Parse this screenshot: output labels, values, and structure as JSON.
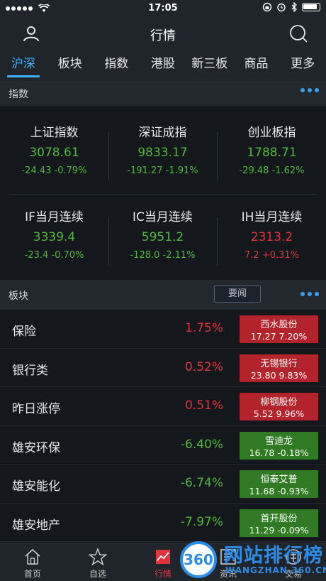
{
  "status_bar": {
    "time": "17:05"
  },
  "nav": {
    "title": "行情"
  },
  "tabs": [
    {
      "label": "沪深",
      "active": true
    },
    {
      "label": "板块"
    },
    {
      "label": "指数"
    },
    {
      "label": "港股"
    },
    {
      "label": "新三板"
    },
    {
      "label": "商品"
    },
    {
      "label": "更多"
    }
  ],
  "indices_section": {
    "label": "指数"
  },
  "indices": [
    {
      "name": "上证指数",
      "price": "3078.61",
      "change": "-24.43 -0.79%",
      "trend": "down"
    },
    {
      "name": "深证成指",
      "price": "9833.17",
      "change": "-191.27 -1.91%",
      "trend": "down"
    },
    {
      "name": "创业板指",
      "price": "1788.71",
      "change": "-29.48 -1.62%",
      "trend": "down"
    },
    {
      "name": "IF当月连续",
      "price": "3339.4",
      "change": "-23.4 -0.70%",
      "trend": "down"
    },
    {
      "name": "IC当月连续",
      "price": "5951.2",
      "change": "-128.0 -2.11%",
      "trend": "down"
    },
    {
      "name": "IH当月连续",
      "price": "2313.2",
      "change": "7.2 +0.31%",
      "trend": "up"
    }
  ],
  "sectors_section": {
    "label": "板块",
    "news_button": "要闻"
  },
  "sectors": [
    {
      "name": "保险",
      "pct": "1.75%",
      "trend": "up",
      "stock": "西水股份",
      "stock_info": "17.27 7.20%"
    },
    {
      "name": "银行类",
      "pct": "0.52%",
      "trend": "up",
      "stock": "无锡银行",
      "stock_info": "23.80 9.83%"
    },
    {
      "name": "昨日涨停",
      "pct": "0.51%",
      "trend": "up",
      "stock": "柳钢股份",
      "stock_info": "5.52 9.96%"
    },
    {
      "name": "雄安环保",
      "pct": "-6.40%",
      "trend": "down",
      "stock": "雪迪龙",
      "stock_info": "16.78 -0.18%"
    },
    {
      "name": "雄安能化",
      "pct": "-6.74%",
      "trend": "down",
      "stock": "恒泰艾普",
      "stock_info": "11.68 -0.93%"
    },
    {
      "name": "雄安地产",
      "pct": "-7.97%",
      "trend": "down",
      "stock": "首开股份",
      "stock_info": "11.29 -0.09%"
    }
  ],
  "bottom_nav": [
    {
      "label": "首页",
      "icon": "home-icon"
    },
    {
      "label": "自选",
      "icon": "star-icon"
    },
    {
      "label": "行情",
      "icon": "chart-icon",
      "active": true
    },
    {
      "label": "资讯",
      "icon": "news-icon"
    },
    {
      "label": "交易",
      "icon": "trade-icon"
    }
  ],
  "watermark": {
    "badge": "360",
    "title": "网站排行榜",
    "subtitle": "WANGZHAN.360.CN"
  },
  "colors": {
    "up": "#e0333c",
    "down": "#4fb83a",
    "accent": "#3ab2ff"
  }
}
